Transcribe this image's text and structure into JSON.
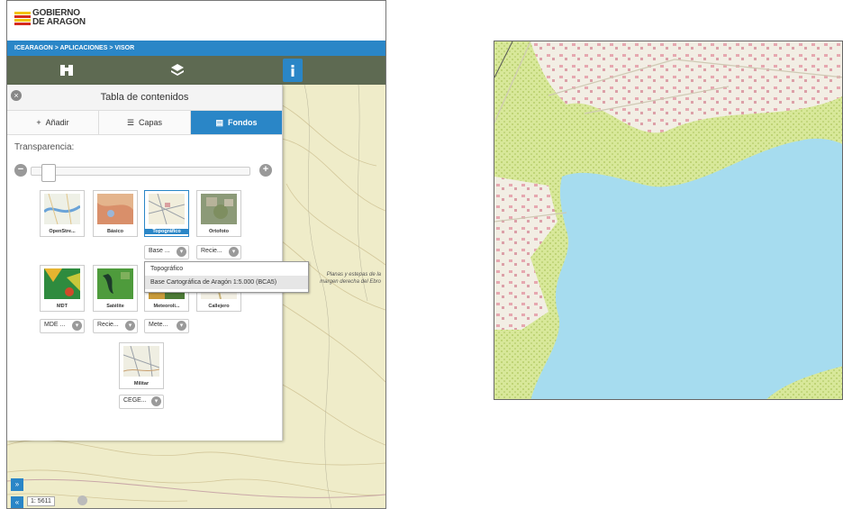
{
  "branding": {
    "line1": "GOBIERNO",
    "line2": "DE ARAGON",
    "flag_colors": [
      "#d52b1e",
      "#f2c200"
    ]
  },
  "breadcrumb": {
    "text": "ICEARAGON > APLICACIONES > VISOR"
  },
  "toolbar": {
    "buttons": [
      {
        "name": "binoculars-icon",
        "glyph": "◉"
      },
      {
        "name": "layers-icon",
        "glyph": "◆"
      },
      {
        "name": "info-icon",
        "glyph": "i"
      }
    ]
  },
  "panel": {
    "title": "Tabla de contenidos",
    "close_glyph": "×",
    "tabs": [
      {
        "icon": "+",
        "label": "Añadir"
      },
      {
        "icon": "☰",
        "label": "Capas"
      },
      {
        "icon": "▤",
        "label": "Fondos"
      }
    ],
    "transparency_label": "Transparencia:",
    "slider_minus": "−",
    "slider_plus": "+",
    "transparency_value": 0.05
  },
  "tiles": [
    {
      "label": "OpenStre...",
      "select": null,
      "selected": false
    },
    {
      "label": "Básico",
      "select": null,
      "selected": false
    },
    {
      "label": "Topográfico",
      "select": "Base ...",
      "selected": true
    },
    {
      "label": "Ortofoto",
      "select": "Recie...",
      "selected": false
    },
    {
      "label": "MDT",
      "select": "MDE ...",
      "selected": false
    },
    {
      "label": "Satélite",
      "select": "Recie...",
      "selected": false
    },
    {
      "label": "Meteoroli...",
      "select": "Mete...",
      "selected": false
    },
    {
      "label": "Callejero",
      "select": null,
      "selected": false
    },
    {
      "label": "Militar",
      "select": "CEGE...",
      "selected": false
    }
  ],
  "dropdown": {
    "options": [
      "Topográfico",
      "Base Cartográfica de Aragón 1:5.000 (BCA5)"
    ],
    "highlighted_index": 1
  },
  "map_note": {
    "text": "Planas y estepas de la margen derecha del Ebro"
  },
  "scale": {
    "prefix": "1:",
    "value": "5611"
  },
  "colors": {
    "accent": "#2a86c7",
    "toolbar": "#5e6a52",
    "water": "#a6dcef",
    "vegetation": "#c6df7c",
    "map_bg": "#efecc9"
  }
}
